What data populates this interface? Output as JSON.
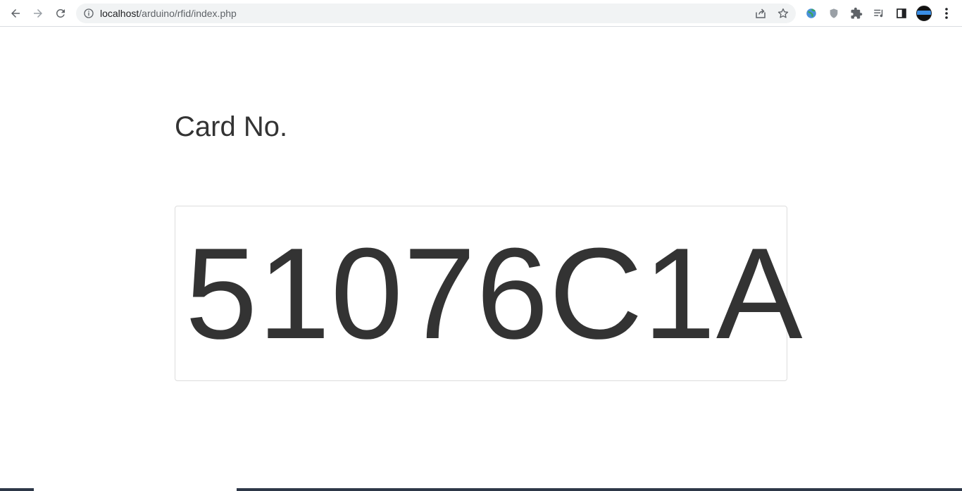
{
  "browser": {
    "url_host": "localhost",
    "url_path": "/arduino/rfid/index.php",
    "icons": {
      "back": "arrow-left-icon",
      "forward": "arrow-right-icon",
      "reload": "reload-icon",
      "info": "info-icon",
      "share": "share-icon",
      "bookmark": "star-icon",
      "extensions": [
        "globe-extension-icon",
        "shield-extension-icon",
        "puzzle-icon",
        "media-queue-icon",
        "side-panel-icon"
      ],
      "profile": "avatar",
      "menu": "kebab-menu-icon"
    }
  },
  "page": {
    "heading": "Card No.",
    "card_number": "51076C1A"
  },
  "colors": {
    "text": "#333333",
    "border": "#dddddd",
    "toolbar_bg": "#ffffff",
    "omnibox_bg": "#f1f3f4"
  }
}
